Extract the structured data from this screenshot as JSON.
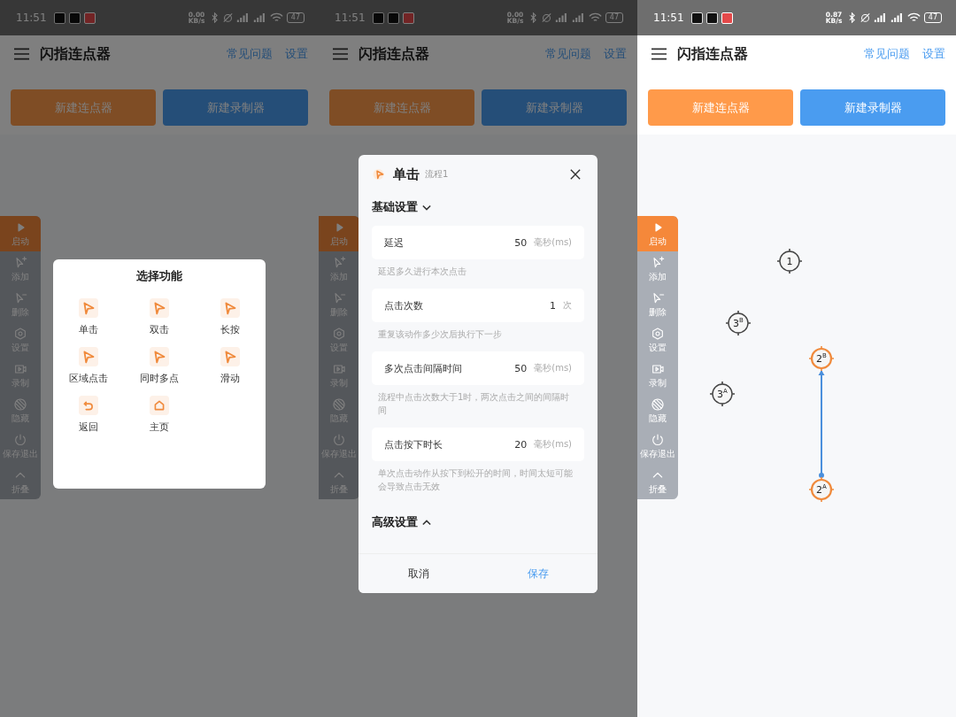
{
  "screens": [
    {
      "dimmed": true,
      "status_bar": {
        "time": "11:51",
        "net_speed": "0.00 KB/s",
        "battery": "47"
      },
      "app_bar": {
        "title": "闪指连点器",
        "links": [
          "常见问题",
          "设置"
        ]
      },
      "actions": [
        {
          "label": "新建连点器",
          "kind": "clicker"
        },
        {
          "label": "新建录制器",
          "kind": "recorder"
        }
      ],
      "toolbar": [
        {
          "label": "启动",
          "kind": "start",
          "selected": true
        },
        {
          "label": "添加",
          "kind": "add",
          "selected": false
        },
        {
          "label": "删除",
          "kind": "remove",
          "selected": false
        },
        {
          "label": "设置",
          "kind": "settings",
          "selected": false
        },
        {
          "label": "录制",
          "kind": "record",
          "selected": false
        },
        {
          "label": "隐藏",
          "kind": "hide",
          "selected": false
        },
        {
          "label": "保存退出",
          "kind": "exit",
          "selected": false
        },
        {
          "label": "折叠",
          "kind": "collapse",
          "selected": false
        }
      ],
      "dialog": {
        "kind": "picker",
        "title": "选择功能",
        "options": [
          {
            "label": "单击",
            "kind": "tap"
          },
          {
            "label": "双击",
            "kind": "tap"
          },
          {
            "label": "长按",
            "kind": "tap"
          },
          {
            "label": "区域点击",
            "kind": "tap"
          },
          {
            "label": "同时多点",
            "kind": "tap"
          },
          {
            "label": "滑动",
            "kind": "tap"
          },
          {
            "label": "返回",
            "kind": "back"
          },
          {
            "label": "主页",
            "kind": "home"
          }
        ]
      }
    },
    {
      "dimmed": true,
      "status_bar": {
        "time": "11:51",
        "net_speed": "0.00 KB/s",
        "battery": "47"
      },
      "app_bar": {
        "title": "闪指连点器",
        "links": [
          "常见问题",
          "设置"
        ]
      },
      "actions": [
        {
          "label": "新建连点器",
          "kind": "clicker"
        },
        {
          "label": "新建录制器",
          "kind": "recorder"
        }
      ],
      "toolbar": [
        {
          "label": "启动",
          "kind": "start",
          "selected": true
        },
        {
          "label": "添加",
          "kind": "add",
          "selected": false
        },
        {
          "label": "删除",
          "kind": "remove",
          "selected": false
        },
        {
          "label": "设置",
          "kind": "settings",
          "selected": false
        },
        {
          "label": "录制",
          "kind": "record",
          "selected": false
        },
        {
          "label": "隐藏",
          "kind": "hide",
          "selected": false
        },
        {
          "label": "保存退出",
          "kind": "exit",
          "selected": false
        },
        {
          "label": "折叠",
          "kind": "collapse",
          "selected": false
        }
      ],
      "dialog": {
        "kind": "editor",
        "title": "单击",
        "subtitle": "流程1",
        "sections": [
          {
            "title": "基础设置",
            "expanded": true,
            "fields": [
              {
                "label": "延迟",
                "value": "50",
                "unit": "毫秒(ms)",
                "hint": "延迟多久进行本次点击"
              },
              {
                "label": "点击次数",
                "value": "1",
                "unit": "次",
                "hint": "重复该动作多少次后执行下一步"
              },
              {
                "label": "多次点击间隔时间",
                "value": "50",
                "unit": "毫秒(ms)",
                "hint": "流程中点击次数大于1时，两次点击之间的间隔时间"
              },
              {
                "label": "点击按下时长",
                "value": "20",
                "unit": "毫秒(ms)",
                "hint": "单次点击动作从按下到松开的时间，时间太短可能会导致点击无效"
              }
            ]
          },
          {
            "title": "高级设置",
            "expanded": false
          }
        ],
        "buttons": [
          {
            "label": "取消",
            "kind": "cancel"
          },
          {
            "label": "保存",
            "kind": "confirm"
          }
        ]
      }
    },
    {
      "dimmed": false,
      "status_bar": {
        "time": "11:51",
        "net_speed": "0.87 KB/s",
        "battery": "47"
      },
      "app_bar": {
        "title": "闪指连点器",
        "links": [
          "常见问题",
          "设置"
        ]
      },
      "actions": [
        {
          "label": "新建连点器",
          "kind": "clicker"
        },
        {
          "label": "新建录制器",
          "kind": "recorder"
        }
      ],
      "toolbar": [
        {
          "label": "启动",
          "kind": "start",
          "selected": true
        },
        {
          "label": "添加",
          "kind": "add",
          "selected": false
        },
        {
          "label": "删除",
          "kind": "remove",
          "selected": false
        },
        {
          "label": "设置",
          "kind": "settings",
          "selected": false
        },
        {
          "label": "录制",
          "kind": "record",
          "selected": false
        },
        {
          "label": "隐藏",
          "kind": "hide",
          "selected": false
        },
        {
          "label": "保存退出",
          "kind": "exit",
          "selected": false
        },
        {
          "label": "折叠",
          "kind": "collapse",
          "selected": false
        }
      ],
      "canvas": {
        "markers": [
          {
            "label": "1",
            "selected": false
          },
          {
            "label": "3$^{B}$",
            "selected": false
          },
          {
            "label": "2$^{B}$",
            "selected": true
          },
          {
            "label": "3$^{A}$",
            "selected": false
          },
          {
            "label": "2$^{A}$",
            "selected": true
          }
        ]
      }
    }
  ]
}
